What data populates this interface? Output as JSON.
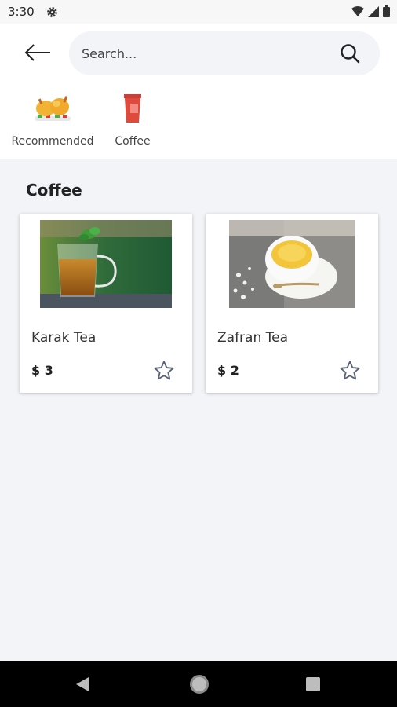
{
  "status_bar": {
    "time": "3:30"
  },
  "search": {
    "placeholder": "Search..."
  },
  "categories": [
    {
      "label": "Recommended",
      "icon": "roast-chicken-icon"
    },
    {
      "label": "Coffee",
      "icon": "coffee-cup-icon"
    }
  ],
  "section": {
    "title": "Coffee"
  },
  "products": [
    {
      "name": "Karak Tea",
      "price": "$ 3",
      "image": "glass-tea-cup-image"
    },
    {
      "name": "Zafran Tea",
      "price": "$ 2",
      "image": "saffron-tea-cup-image"
    }
  ],
  "colors": {
    "accent_red": "#e04a3c",
    "background": "#f2f4f8",
    "card": "#ffffff",
    "star_outline": "#5a6275"
  }
}
